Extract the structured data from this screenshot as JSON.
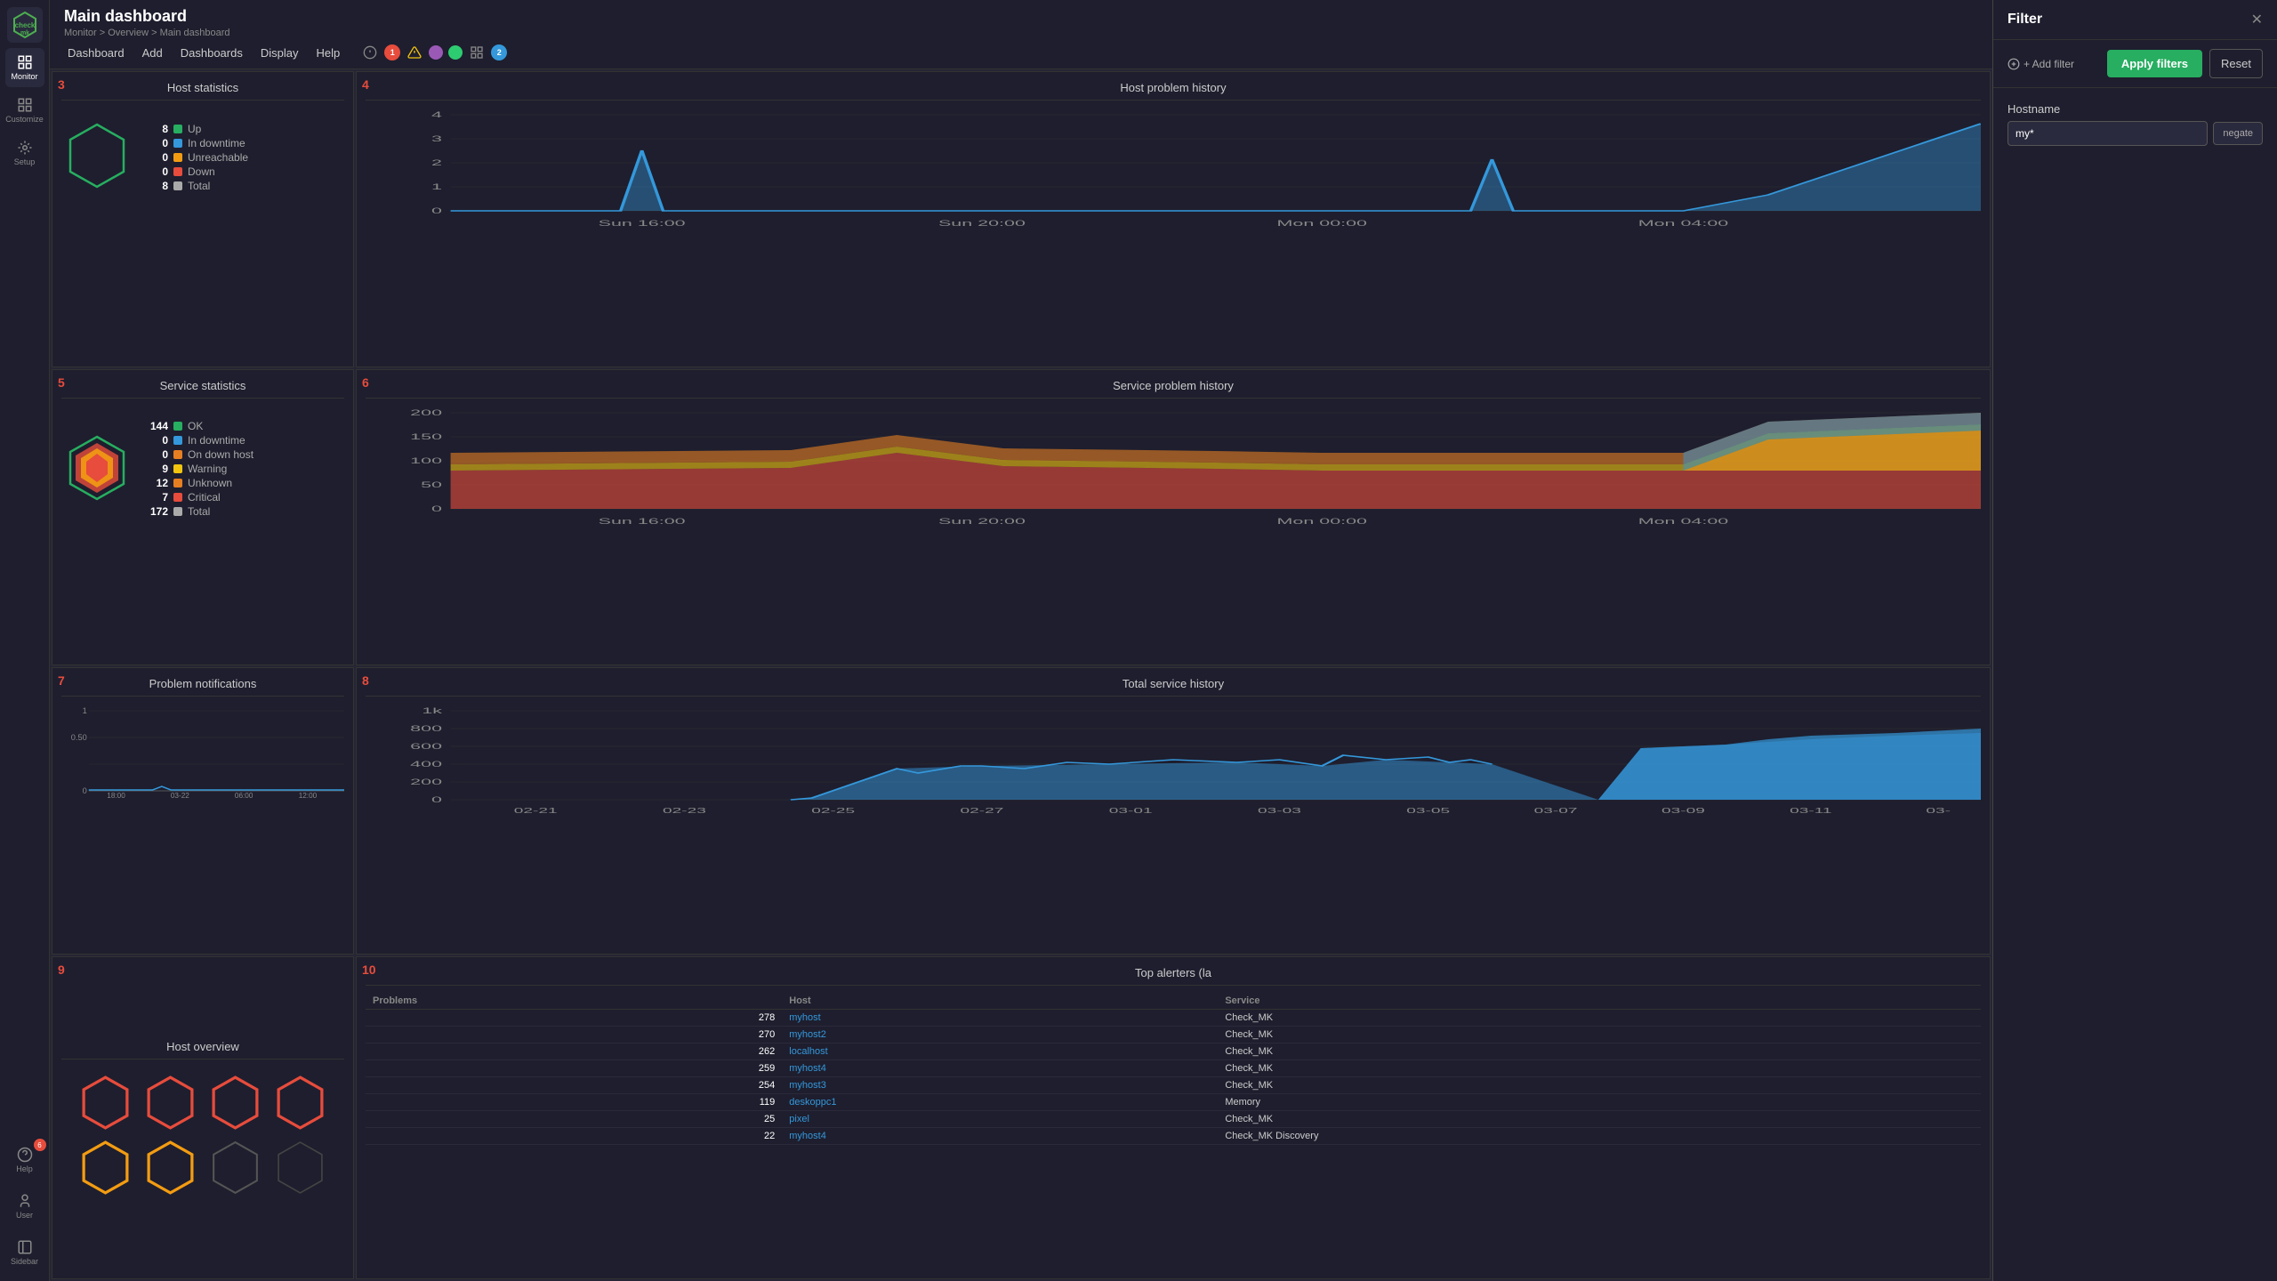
{
  "app": {
    "name": "checkmk",
    "title": "Main dashboard",
    "breadcrumb": "Monitor > Overview > Main dashboard"
  },
  "nav": {
    "items": [
      "Dashboard",
      "Add",
      "Dashboards",
      "Display",
      "Help"
    ],
    "num1": "1",
    "num2": "2"
  },
  "sidebar": {
    "items": [
      {
        "label": "Monitor",
        "icon": "monitor"
      },
      {
        "label": "Customize",
        "icon": "customize"
      },
      {
        "label": "Setup",
        "icon": "setup"
      }
    ],
    "bottom": [
      {
        "label": "Help",
        "icon": "help",
        "badge": "6"
      },
      {
        "label": "User",
        "icon": "user"
      },
      {
        "label": "Sidebar",
        "icon": "sidebar"
      }
    ]
  },
  "filter": {
    "title": "Filter",
    "add_filter_label": "+ Add filter",
    "apply_label": "Apply filters",
    "reset_label": "Reset",
    "hostname_label": "Hostname",
    "hostname_value": "my*",
    "negate_label": "negate"
  },
  "host_stats": {
    "widget_num": "3",
    "title": "Host statistics",
    "rows": [
      {
        "num": "8",
        "label": "Up",
        "color": "#27ae60"
      },
      {
        "num": "0",
        "label": "In downtime",
        "color": "#3498db"
      },
      {
        "num": "0",
        "label": "Unreachable",
        "color": "#f39c12"
      },
      {
        "num": "0",
        "label": "Down",
        "color": "#e74c3c"
      },
      {
        "num": "8",
        "label": "Total",
        "color": "#fff"
      }
    ]
  },
  "host_problem_history": {
    "widget_num": "4",
    "title": "Host problem history",
    "y_labels": [
      "4",
      "3",
      "2",
      "1",
      "0"
    ],
    "x_labels": [
      "Sun 16:00",
      "Sun 20:00",
      "Mon 00:00",
      "Mon 04:00"
    ]
  },
  "service_stats": {
    "widget_num": "5",
    "title": "Service statistics",
    "rows": [
      {
        "num": "144",
        "label": "OK",
        "color": "#27ae60"
      },
      {
        "num": "0",
        "label": "In downtime",
        "color": "#3498db"
      },
      {
        "num": "0",
        "label": "On down host",
        "color": "#e67e22"
      },
      {
        "num": "9",
        "label": "Warning",
        "color": "#f1c40f"
      },
      {
        "num": "12",
        "label": "Unknown",
        "color": "#e67e22"
      },
      {
        "num": "7",
        "label": "Critical",
        "color": "#e74c3c"
      },
      {
        "num": "172",
        "label": "Total",
        "color": "#fff"
      }
    ]
  },
  "service_problem_history": {
    "widget_num": "6",
    "title": "Service problem history",
    "y_labels": [
      "200",
      "150",
      "100",
      "50",
      "0"
    ],
    "x_labels": [
      "Sun 16:00",
      "Sun 20:00",
      "Mon 00:00",
      "Mon 04:00"
    ]
  },
  "problem_notifications": {
    "widget_num": "7",
    "title": "Problem notifications",
    "y_labels": [
      "1",
      "0.50",
      "0"
    ],
    "x_labels": [
      "18:00",
      "03-22",
      "06:00",
      "12:00"
    ]
  },
  "total_service_history": {
    "widget_num": "8",
    "title": "Total service history",
    "y_labels": [
      "1k",
      "800",
      "600",
      "400",
      "200",
      "0"
    ],
    "x_labels": [
      "02-21",
      "02-23",
      "02-25",
      "02-27",
      "03-01",
      "03-03",
      "03-05",
      "03-07",
      "03-09",
      "03-11",
      "03-"
    ]
  },
  "host_overview": {
    "widget_num": "9",
    "title": "Host overview",
    "hexagons": [
      {
        "color": "#e74c3c",
        "filled": false
      },
      {
        "color": "#e74c3c",
        "filled": false
      },
      {
        "color": "#e74c3c",
        "filled": false
      },
      {
        "color": "#e74c3c",
        "filled": false
      },
      {
        "color": "#f39c12",
        "filled": false
      },
      {
        "color": "#f39c12",
        "filled": false
      },
      {
        "color": "#555",
        "filled": false
      },
      {
        "color": "#444",
        "filled": false
      }
    ]
  },
  "top_alerters": {
    "widget_num": "10",
    "title": "Top alerters (la",
    "columns": [
      "Problems",
      "Host",
      "Service"
    ],
    "rows": [
      {
        "problems": "278",
        "host": "myhost",
        "service": "Check_MK"
      },
      {
        "problems": "270",
        "host": "myhost2",
        "service": "Check_MK"
      },
      {
        "problems": "262",
        "host": "localhost",
        "service": "Check_MK"
      },
      {
        "problems": "259",
        "host": "myhost4",
        "service": "Check_MK"
      },
      {
        "problems": "254",
        "host": "myhost3",
        "service": "Check_MK"
      },
      {
        "problems": "119",
        "host": "deskoppc1",
        "service": "Memory"
      },
      {
        "problems": "25",
        "host": "pixel",
        "service": "Check_MK"
      },
      {
        "problems": "22",
        "host": "myhost4",
        "service": "Check_MK Discovery"
      }
    ]
  }
}
